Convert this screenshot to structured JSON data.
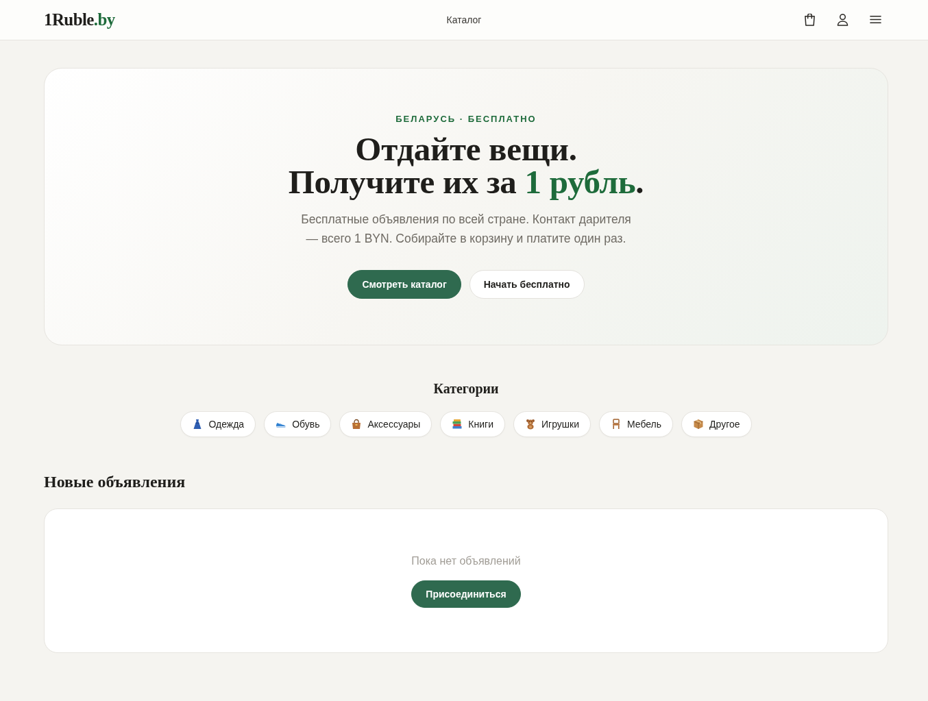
{
  "header": {
    "logo": {
      "name": "1Ruble",
      "domain": ".by"
    },
    "nav": [
      {
        "label": "Каталог"
      }
    ]
  },
  "hero": {
    "eyebrow": "БЕЛАРУСЬ · БЕСПЛАТНО",
    "headline": [
      [
        {
          "text": "Отдайте вещи.",
          "highlight": false
        }
      ],
      [
        {
          "text": "Получите их за ",
          "highlight": false
        },
        {
          "text": "1 рубль",
          "highlight": true
        },
        {
          "text": ".",
          "highlight": false
        }
      ]
    ],
    "subtitle": "Бесплатные объявления по всей стране. Контакт дарителя — всего 1 BYN. Собирайте в корзину и платите один раз.",
    "buttons": [
      {
        "label": "Смотреть каталог",
        "kind": "primary"
      },
      {
        "label": "Начать бесплатно",
        "kind": "secondary"
      }
    ]
  },
  "categories": {
    "title": "Категории",
    "items": [
      {
        "label": "Одежда"
      },
      {
        "label": "Обувь"
      },
      {
        "label": "Аксессуары"
      },
      {
        "label": "Книги"
      },
      {
        "label": "Игрушки"
      },
      {
        "label": "Мебель"
      },
      {
        "label": "Другое"
      }
    ]
  },
  "listings": {
    "title": "Новые объявления",
    "empty_text": "Пока нет объявлений",
    "button": {
      "label": "Присоединиться",
      "kind": "primary"
    }
  }
}
